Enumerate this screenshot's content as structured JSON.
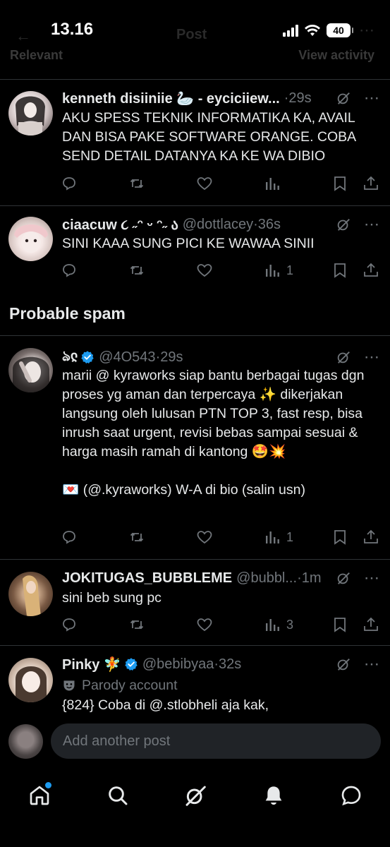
{
  "status_bar": {
    "time": "13.16",
    "battery": "40"
  },
  "header": {
    "title": "Post",
    "tab_left": "Relevant",
    "tab_right": "View activity"
  },
  "section": {
    "probable_spam_title": "Probable spam"
  },
  "posts": [
    {
      "name": "kenneth disiiniie 🦢 - eyciciiew...",
      "handle": "",
      "time": "29s",
      "text": "AKU SPESS TEKNIK INFORMATIKA KA, AVAIL DAN BISA PAKE SOFTWARE ORANGE. COBA SEND DETAIL DATANYA KA KE WA DIBIO",
      "views": ""
    },
    {
      "name": "ciaacuw ૮ ˶ᵔ ᵕ ᵔ˶ ა",
      "handle": "@dottlacey",
      "time": "36s",
      "text": "SINI KAAA SUNG PICI KE WAWAA SINII",
      "views": "1"
    },
    {
      "name": "ঌჺ",
      "handle": "@4O543",
      "time": "29s",
      "text": "marii @ kyraworks siap bantu berbagai tugas dgn proses yg aman dan terpercaya ✨ dikerjakan langsung oleh lulusan PTN TOP 3, fast resp, bisa inrush saat urgent, revisi bebas sampai sesuai & harga masih ramah di kantong 🤩💥\n\n💌 (@.kyraworks) W-A di bio (salin usn)",
      "views": "1"
    },
    {
      "name": "JOKITUGAS_BUBBLEME",
      "handle": "@bubbl...",
      "time": "1m",
      "text": "sini beb sung pc",
      "views": "3"
    },
    {
      "name": "Pinky 🧚",
      "handle": "@bebibyaa",
      "time": "32s",
      "parody_label": "Parody account",
      "text": "{824} Coba di @.stlobheli aja kak,",
      "views": ""
    }
  ],
  "composer": {
    "placeholder": "Add another post"
  },
  "nav": {
    "items": [
      "home-icon",
      "search-icon",
      "grok-icon",
      "notifications-icon",
      "messages-icon"
    ]
  },
  "colors": {
    "background": "#000000",
    "text": "#e7e9ea",
    "muted": "#71767b",
    "accent": "#1d9bf0",
    "divider": "#2f3336"
  }
}
